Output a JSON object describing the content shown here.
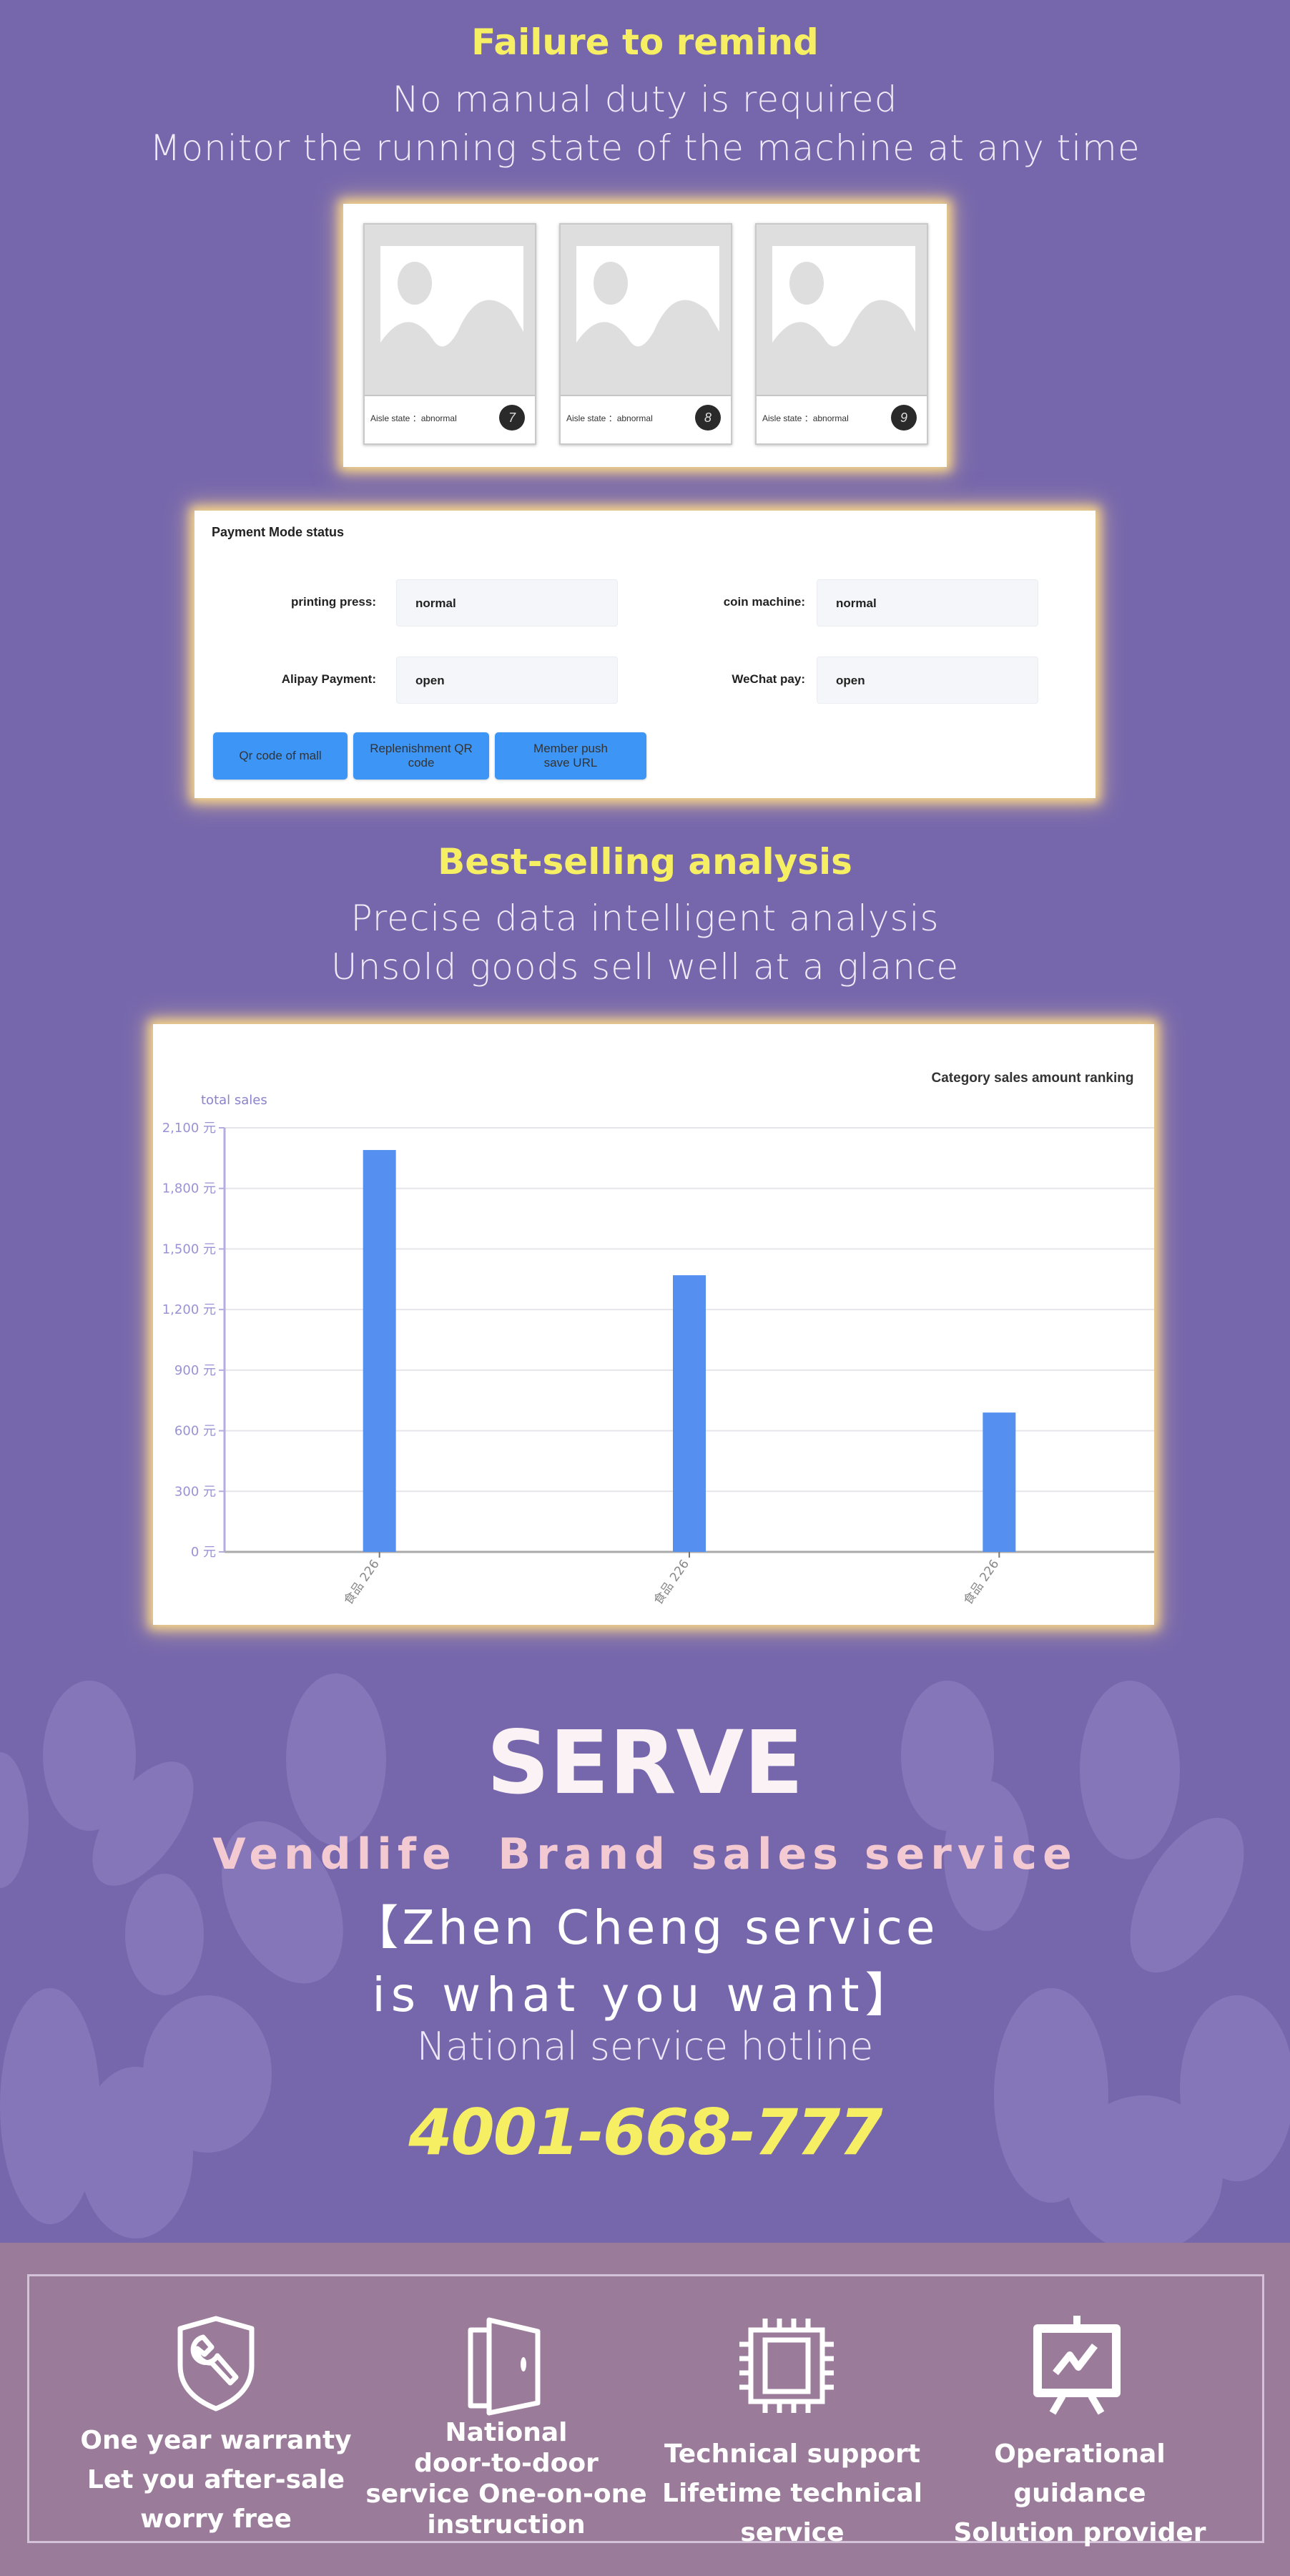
{
  "failure_section": {
    "title": "Failure to remind",
    "lines": [
      "No manual duty is required",
      "Monitor the running state of the machine at any time"
    ]
  },
  "aisles": [
    {
      "state_label": "Aisle state",
      "state_value": "abnormal",
      "number": "7"
    },
    {
      "state_label": "Aisle state",
      "state_value": "abnormal",
      "number": "8"
    },
    {
      "state_label": "Aisle state",
      "state_value": "abnormal",
      "number": "9"
    }
  ],
  "payment": {
    "title": "Payment Mode status",
    "fields": [
      {
        "label": "printing press:",
        "value": "normal"
      },
      {
        "label": "coin machine:",
        "value": "normal"
      },
      {
        "label": "Alipay Payment:",
        "value": "open"
      },
      {
        "label": "WeChat pay:",
        "value": "open"
      }
    ],
    "buttons": [
      "Qr code of mall",
      "Replenishment QR code",
      "Member push save URL"
    ]
  },
  "bestselling_section": {
    "title": "Best-selling analysis",
    "lines": [
      "Precise data intelligent analysis",
      "Unsold goods sell well at a glance"
    ]
  },
  "chart_data": {
    "type": "bar",
    "title": "Category sales amount ranking",
    "ylabel": "total sales",
    "xlabel": "",
    "categories": [
      "食品 226",
      "食品 226",
      "食品 226"
    ],
    "values": [
      1990,
      1370,
      690
    ],
    "ylim": [
      0,
      2100
    ],
    "yticks": [
      0,
      300,
      600,
      900,
      1200,
      1500,
      1800,
      2100
    ],
    "ytick_labels": [
      "0 元",
      "300 元",
      "600 元",
      "900 元",
      "1,200 元",
      "1,500 元",
      "1,800 元",
      "2,100 元"
    ],
    "grid": true,
    "bar_color": "#5590f0"
  },
  "serve": {
    "title": "SERVE",
    "brand_line": "Vendlife  Brand sales service",
    "slogan_line1": "【Zhen Cheng service",
    "slogan_line2": "is what you want】",
    "hotline_label": "National service hotline",
    "hotline_number": "4001-668-777"
  },
  "features": [
    {
      "icon": "shield-wrench-icon",
      "lines": [
        "One year warranty",
        "Let you after-sale",
        "worry free"
      ]
    },
    {
      "icon": "door-icon",
      "lines": [
        "National",
        "door-to-door",
        "service One-on-one",
        "instruction"
      ]
    },
    {
      "icon": "chip-icon",
      "lines": [
        "Technical support",
        "Lifetime technical",
        "service"
      ]
    },
    {
      "icon": "presentation-chart-icon",
      "lines": [
        "Operational guidance",
        "Solution provider"
      ]
    }
  ],
  "colors": {
    "background": "#7667ad",
    "accent_yellow": "#f7ef63",
    "brand_pink": "#f3c9d2",
    "button_blue": "#3d95f5",
    "footer_bg": "#9b7b9a"
  }
}
